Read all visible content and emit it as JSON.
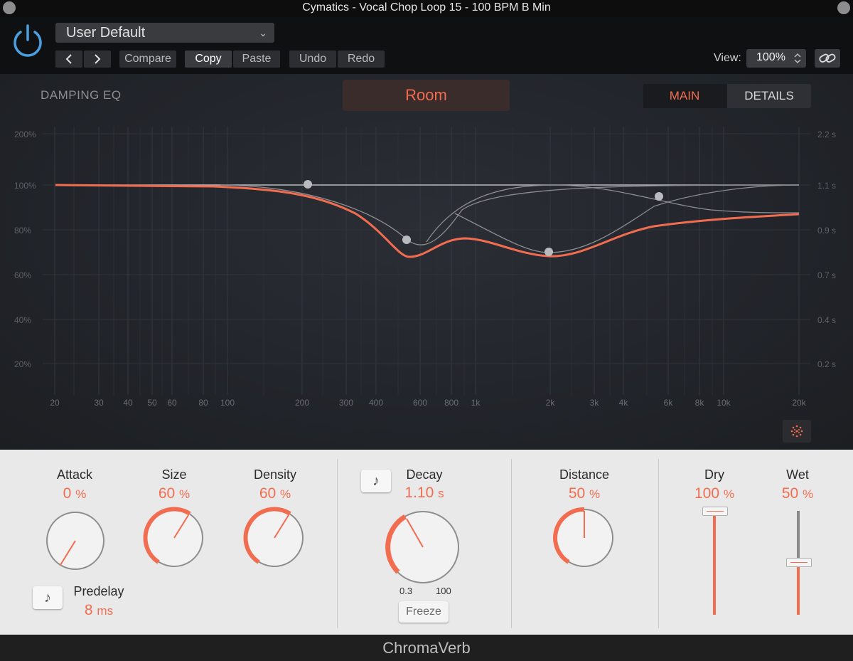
{
  "window": {
    "title": "Cymatics - Vocal Chop Loop 15 - 100 BPM B Min"
  },
  "header": {
    "preset": "User Default",
    "compare": "Compare",
    "copy": "Copy",
    "paste": "Paste",
    "undo": "Undo",
    "redo": "Redo",
    "view_label": "View:",
    "zoom": "100%"
  },
  "plugin": {
    "section_label": "DAMPING EQ",
    "room_type": "Room",
    "tabs": [
      {
        "label": "MAIN",
        "active": true
      },
      {
        "label": "DETAILS",
        "active": false
      }
    ]
  },
  "eq": {
    "y_left_labels": [
      "200%",
      "100%",
      "80%",
      "60%",
      "40%",
      "20%"
    ],
    "y_right_labels": [
      "2.2 s",
      "1.1 s",
      "0.9 s",
      "0.7 s",
      "0.4 s",
      "0.2 s"
    ],
    "x_labels": [
      "20",
      "30",
      "40",
      "50",
      "60",
      "80",
      "100",
      "200",
      "300",
      "400",
      "600",
      "800",
      "1k",
      "2k",
      "3k",
      "4k",
      "6k",
      "8k",
      "10k",
      "20k"
    ],
    "accent": "#f26d4f"
  },
  "controls": {
    "attack": {
      "label": "Attack",
      "value": "0",
      "unit": "%"
    },
    "size": {
      "label": "Size",
      "value": "60",
      "unit": "%"
    },
    "density": {
      "label": "Density",
      "value": "60",
      "unit": "%"
    },
    "predelay": {
      "label": "Predelay",
      "value": "8",
      "unit": "ms"
    },
    "decay": {
      "label": "Decay",
      "value": "1.10",
      "unit": "s",
      "range_min": "0.3",
      "range_max": "100"
    },
    "freeze": "Freeze",
    "distance": {
      "label": "Distance",
      "value": "50",
      "unit": "%"
    },
    "dry": {
      "label": "Dry",
      "value": "100",
      "unit": "%"
    },
    "wet": {
      "label": "Wet",
      "value": "50",
      "unit": "%"
    }
  },
  "footer": {
    "brand": "ChromaVerb"
  }
}
